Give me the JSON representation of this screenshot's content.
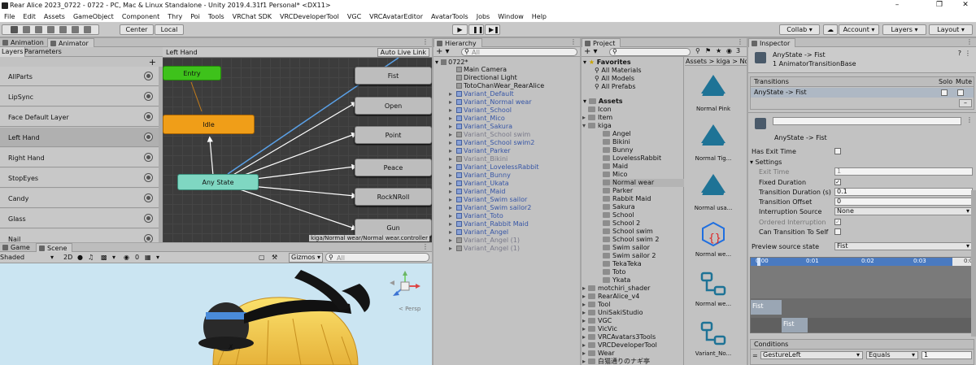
{
  "window": {
    "title": "Rear Alice 2023_0722 - 0722 - PC, Mac & Linux Standalone - Unity 2019.4.31f1 Personal* <DX11>"
  },
  "menu": [
    "File",
    "Edit",
    "Assets",
    "GameObject",
    "Component",
    "Thry",
    "Poi",
    "Tools",
    "VRChat SDK",
    "VRCDeveloperTool",
    "VGC",
    "VRCAvatarEditor",
    "AvatarTools",
    "Jobs",
    "Window",
    "Help"
  ],
  "toolbar": {
    "center": "Center",
    "local": "Local",
    "collab": "Collab",
    "account": "Account",
    "layers": "Layers",
    "layout": "Layout"
  },
  "animator": {
    "tabs": [
      "Animation",
      "Animator"
    ],
    "subtabs": [
      "Layers",
      "Parameters"
    ],
    "breadcrumb": "Left Hand",
    "auto_live_link": "Auto Live Link",
    "layers": [
      "AllParts",
      "LipSync",
      "Face Default Layer",
      "Left Hand",
      "Right Hand",
      "StopEyes",
      "Candy",
      "Glass",
      "Nail"
    ],
    "selected_layer": "Left Hand",
    "nodes": {
      "entry": "Entry",
      "idle": "Idle",
      "any_state": "Any State",
      "states": [
        "Fist",
        "Open",
        "Point",
        "Peace",
        "RockNRoll",
        "Gun"
      ]
    },
    "controller_path": "kiga/Normal wear/Normal wear.controller"
  },
  "scene": {
    "tabs": [
      "Game",
      "Scene"
    ],
    "shading": "Shaded",
    "mode2d": "2D",
    "gizmos": "Gizmos",
    "search_placeholder": "All",
    "fx_count": "0",
    "persp": "< Persp"
  },
  "hierarchy": {
    "tab": "Hierarchy",
    "search_placeholder": "All",
    "root": "0722*",
    "items": [
      {
        "label": "Main Camera",
        "style": "normal",
        "depth": 1
      },
      {
        "label": "Directional Light",
        "style": "normal",
        "depth": 1
      },
      {
        "label": "TotoChanWear_RearAlice",
        "style": "normal",
        "depth": 1
      },
      {
        "label": "Variant_Default",
        "style": "blue",
        "depth": 1
      },
      {
        "label": "Variant_Normal wear",
        "style": "blue",
        "depth": 1
      },
      {
        "label": "Variant_School",
        "style": "blue",
        "depth": 1
      },
      {
        "label": "Variant_Mico",
        "style": "blue",
        "depth": 1
      },
      {
        "label": "Variant_Sakura",
        "style": "blue",
        "depth": 1
      },
      {
        "label": "Variant_School swim",
        "style": "gray",
        "depth": 1
      },
      {
        "label": "Variant_School swim2",
        "style": "blue",
        "depth": 1
      },
      {
        "label": "Variant_Parker",
        "style": "blue",
        "depth": 1
      },
      {
        "label": "Variant_Bikini",
        "style": "gray",
        "depth": 1
      },
      {
        "label": "Variant_LovelessRabbit",
        "style": "blue",
        "depth": 1
      },
      {
        "label": "Variant_Bunny",
        "style": "blue",
        "depth": 1
      },
      {
        "label": "Variant_Ukata",
        "style": "blue",
        "depth": 1
      },
      {
        "label": "Variant_Maid",
        "style": "blue",
        "depth": 1
      },
      {
        "label": "Variant_Swim sailor",
        "style": "blue",
        "depth": 1
      },
      {
        "label": "Variant_Swim sailor2",
        "style": "blue",
        "depth": 1
      },
      {
        "label": "Variant_Toto",
        "style": "blue",
        "depth": 1
      },
      {
        "label": "Variant_Rabbit Maid",
        "style": "blue",
        "depth": 1
      },
      {
        "label": "Variant_Angel",
        "style": "blue",
        "depth": 1
      },
      {
        "label": "Variant_Angel (1)",
        "style": "gray",
        "depth": 1
      },
      {
        "label": "Variant_Angel (1)",
        "style": "gray",
        "depth": 1
      }
    ]
  },
  "project": {
    "tab": "Project",
    "search_placeholder": "",
    "favorites": "Favorites",
    "fav_items": [
      "All Materials",
      "All Models",
      "All Prefabs"
    ],
    "assets": "Assets",
    "tree": [
      {
        "label": "Icon",
        "depth": 1
      },
      {
        "label": "Item",
        "depth": 1,
        "exp": ">"
      },
      {
        "label": "kiga",
        "depth": 1,
        "exp": "v"
      },
      {
        "label": "Angel",
        "depth": 2
      },
      {
        "label": "Bikini",
        "depth": 2
      },
      {
        "label": "Bunny",
        "depth": 2
      },
      {
        "label": "LovelessRabbit",
        "depth": 2
      },
      {
        "label": "Maid",
        "depth": 2
      },
      {
        "label": "Mico",
        "depth": 2
      },
      {
        "label": "Normal wear",
        "depth": 2,
        "sel": true
      },
      {
        "label": "Parker",
        "depth": 2
      },
      {
        "label": "Rabbit Maid",
        "depth": 2
      },
      {
        "label": "Sakura",
        "depth": 2
      },
      {
        "label": "School",
        "depth": 2
      },
      {
        "label": "School 2",
        "depth": 2
      },
      {
        "label": "School swim",
        "depth": 2
      },
      {
        "label": "School swim 2",
        "depth": 2
      },
      {
        "label": "Swim sailor",
        "depth": 2
      },
      {
        "label": "Swim sailor 2",
        "depth": 2
      },
      {
        "label": "TekaTeka",
        "depth": 2
      },
      {
        "label": "Toto",
        "depth": 2
      },
      {
        "label": "Ykata",
        "depth": 2
      },
      {
        "label": "motchiri_shader",
        "depth": 1,
        "exp": ">"
      },
      {
        "label": "RearAlice_v4",
        "depth": 1,
        "exp": ">"
      },
      {
        "label": "Tool",
        "depth": 1,
        "exp": ">"
      },
      {
        "label": "UniSakiStudio",
        "depth": 1,
        "exp": ">"
      },
      {
        "label": "VGC",
        "depth": 1,
        "exp": ">"
      },
      {
        "label": "VicVic",
        "depth": 1,
        "exp": ">"
      },
      {
        "label": "VRCAvatars3Tools",
        "depth": 1,
        "exp": ">"
      },
      {
        "label": "VRCDeveloperTool",
        "depth": 1,
        "exp": ">"
      },
      {
        "label": "Wear",
        "depth": 1,
        "exp": ">"
      },
      {
        "label": "白猫通りのナギ亭",
        "depth": 1,
        "exp": ">"
      }
    ],
    "breadcrumb": [
      "Assets",
      ">",
      "kiga",
      ">",
      "Norm"
    ],
    "icon_count": "3",
    "grid": [
      {
        "label": "Normal Pink",
        "icon": "animation-clip-icon"
      },
      {
        "label": "Normal Tig...",
        "icon": "animation-clip-icon"
      },
      {
        "label": "Normal usa...",
        "icon": "animation-clip-icon"
      },
      {
        "label": "Normal we...",
        "icon": "expression-parameters-icon"
      },
      {
        "label": "Normal we...",
        "icon": "animator-controller-icon"
      },
      {
        "label": "Variant_No...",
        "icon": "animator-controller-icon"
      }
    ]
  },
  "inspector": {
    "tab": "Inspector",
    "title": "AnyState -> Fist",
    "subtitle": "1 AnimatorTransitionBase",
    "transitions_header": "Transitions",
    "solo": "Solo",
    "mute": "Mute",
    "transition_row": "AnyState -> Fist",
    "name_field": "",
    "transition_label": "AnyState -> Fist",
    "has_exit_time": "Has Exit Time",
    "settings": "Settings",
    "exit_time": "Exit Time",
    "exit_time_val": "1",
    "fixed_duration": "Fixed Duration",
    "transition_duration": "Transition Duration (s)",
    "transition_duration_val": "0.1",
    "transition_offset": "Transition Offset",
    "transition_offset_val": "0",
    "interruption_source": "Interruption Source",
    "interruption_source_val": "None",
    "ordered_interruption": "Ordered Interruption",
    "can_transition_to_self": "Can Transition To Self",
    "preview_source_state": "Preview source state",
    "preview_source_val": "Fist",
    "timeline_ticks": [
      "0:00",
      "0:01",
      "0:02",
      "0:03",
      "0:04"
    ],
    "timeline_labels": [
      "Fist",
      "Fist"
    ],
    "conditions": "Conditions",
    "cond_param": "GestureLeft",
    "cond_op": "Equals",
    "cond_val": "1"
  }
}
